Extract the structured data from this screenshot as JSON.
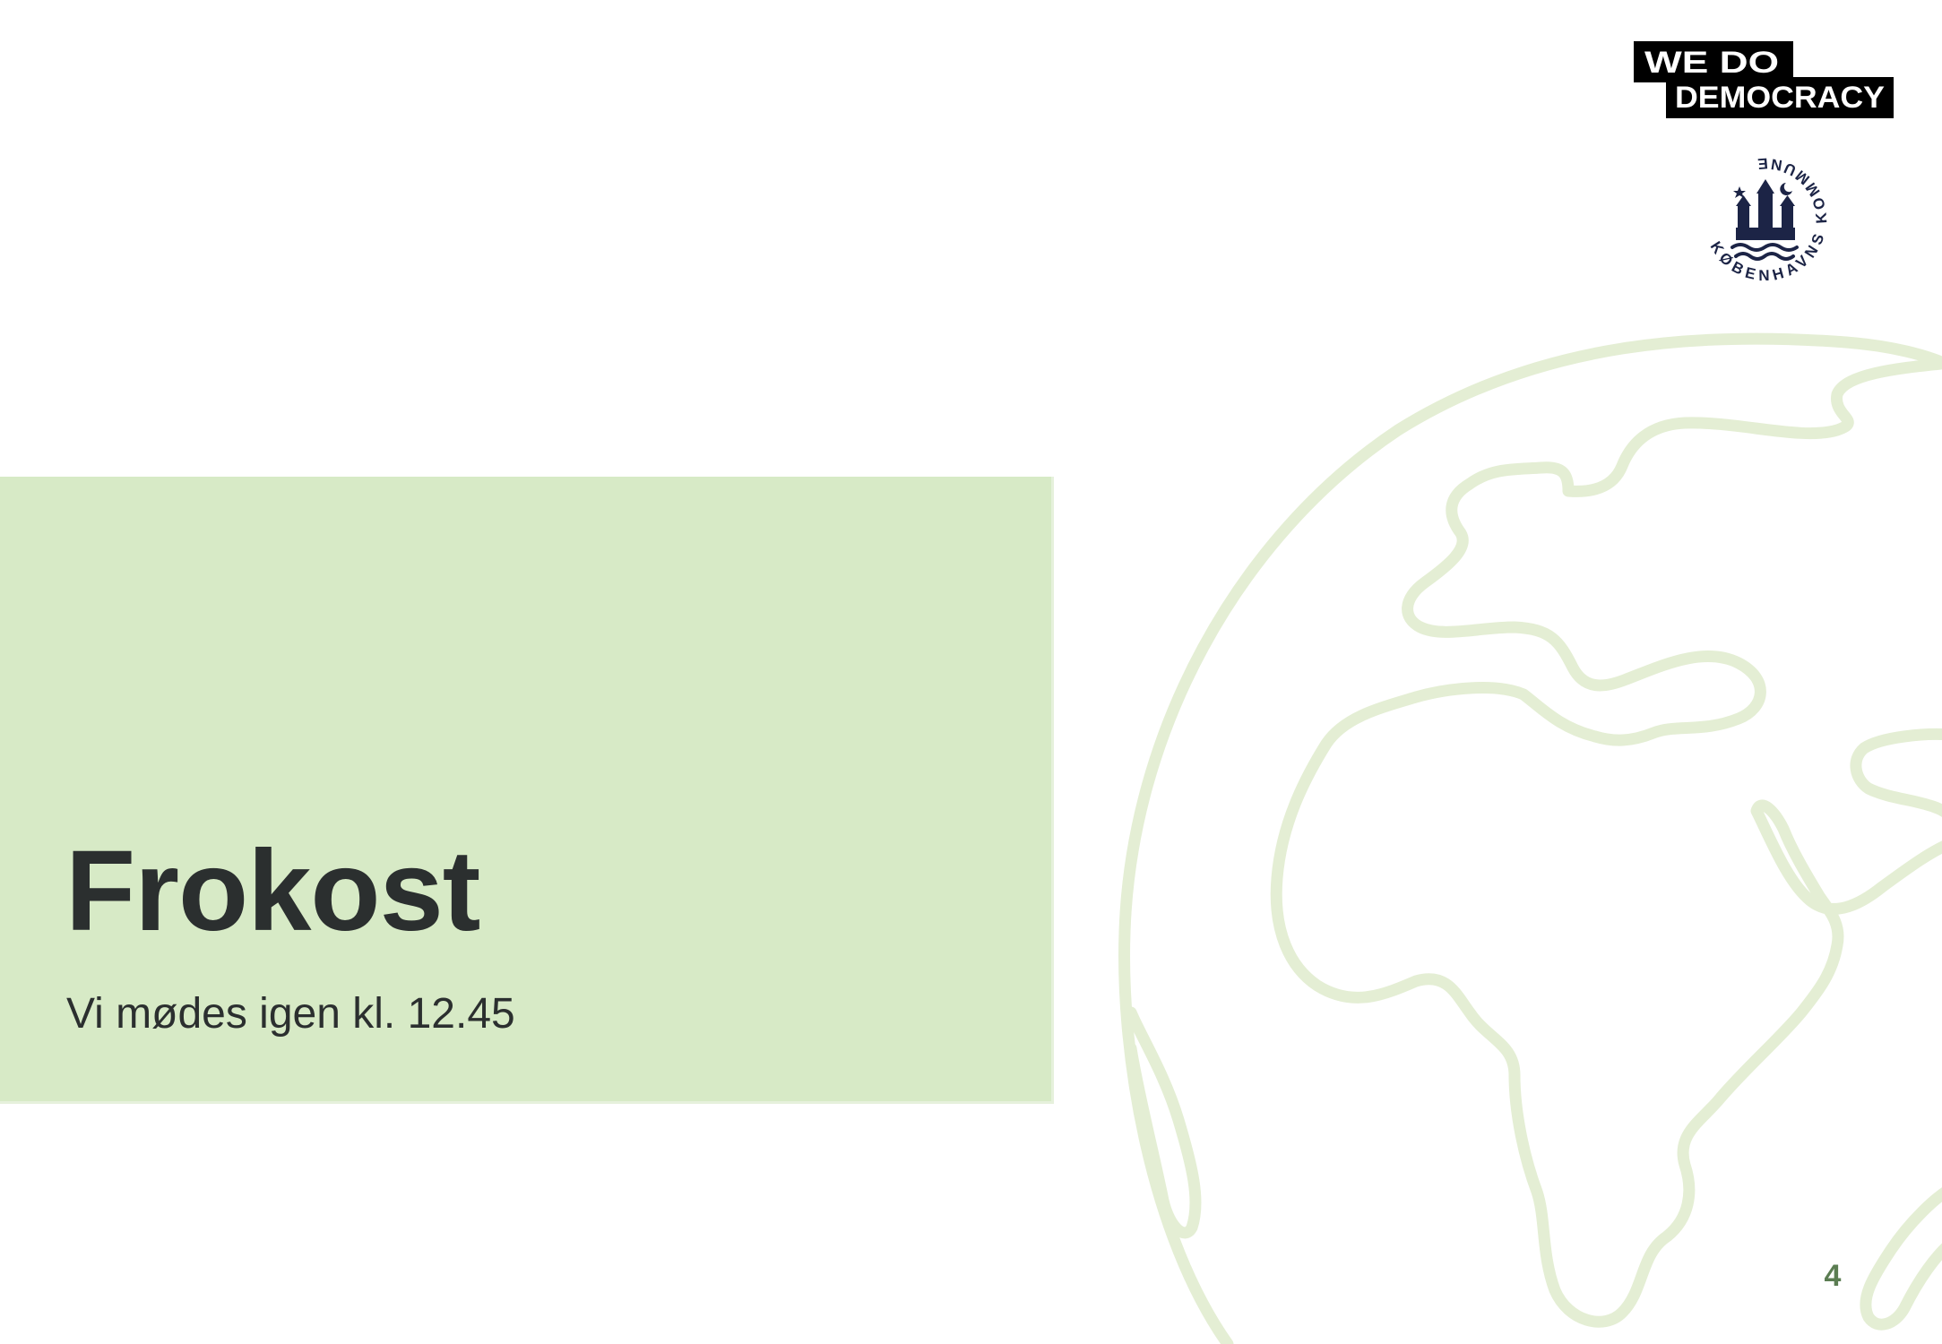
{
  "slide": {
    "title": "Frokost",
    "subtitle": "Vi mødes igen kl. 12.45",
    "page_number": "4"
  },
  "logos": {
    "we_do_democracy": {
      "line1": "WE DO",
      "line2": "DEMOCRACY"
    },
    "kobenhavns_kommune": {
      "ring_text": "KØBENHAVNS KOMMUNE"
    }
  },
  "colors": {
    "panel_background": "#d7eac6",
    "globe_outline": "#e4eed4",
    "title_text": "#2b2f2f",
    "page_number": "#5b7d52",
    "seal_navy": "#1c2446",
    "logo_black": "#000000"
  },
  "icons": {
    "globe": "globe-outline-icon",
    "seal": "copenhagen-coat-of-arms-icon"
  }
}
